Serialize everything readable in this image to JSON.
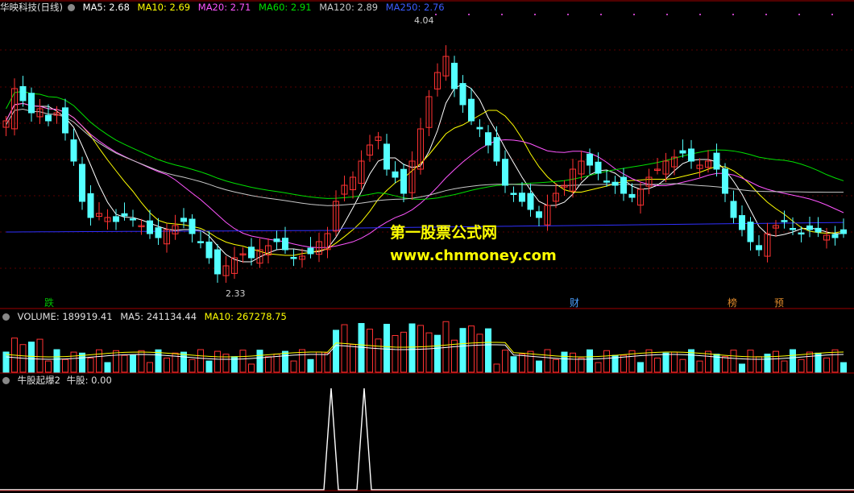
{
  "price_header": {
    "title": "华映科技(日线)",
    "ma5_label": "MA5: 2.68",
    "ma10_label": "MA10: 2.69",
    "ma20_label": "MA20: 2.71",
    "ma60_label": "MA60: 2.91",
    "ma120_label": "MA120: 2.89",
    "ma250_label": "MA250: 2.76"
  },
  "volume_header": {
    "volume_label": "VOLUME: 189919.41",
    "ma5_label": "MA5: 241134.44",
    "ma10_label": "MA10: 267278.75"
  },
  "indicator_header": {
    "name": "牛股起爆2",
    "value_label": "牛股: 0.00"
  },
  "price_marks": {
    "high": "4.04",
    "low": "2.33"
  },
  "event_tags": [
    {
      "text": "跌",
      "color": "#00c000"
    },
    {
      "text": "财",
      "color": "#4aa0ff"
    },
    {
      "text": "榜",
      "color": "#e08a2a"
    },
    {
      "text": "预",
      "color": "#e08a2a"
    }
  ],
  "watermark": {
    "line1": "第一股票公式网",
    "line2": "www.chnmoney.com"
  },
  "colors": {
    "up": "#ff3232",
    "down": "#54ffff",
    "ma5": "#ffffff",
    "ma10": "#ffff00",
    "ma20": "#ff55ff",
    "ma60": "#00e000",
    "ma120": "#c8c8c8",
    "ma250": "#3030ff"
  }
}
